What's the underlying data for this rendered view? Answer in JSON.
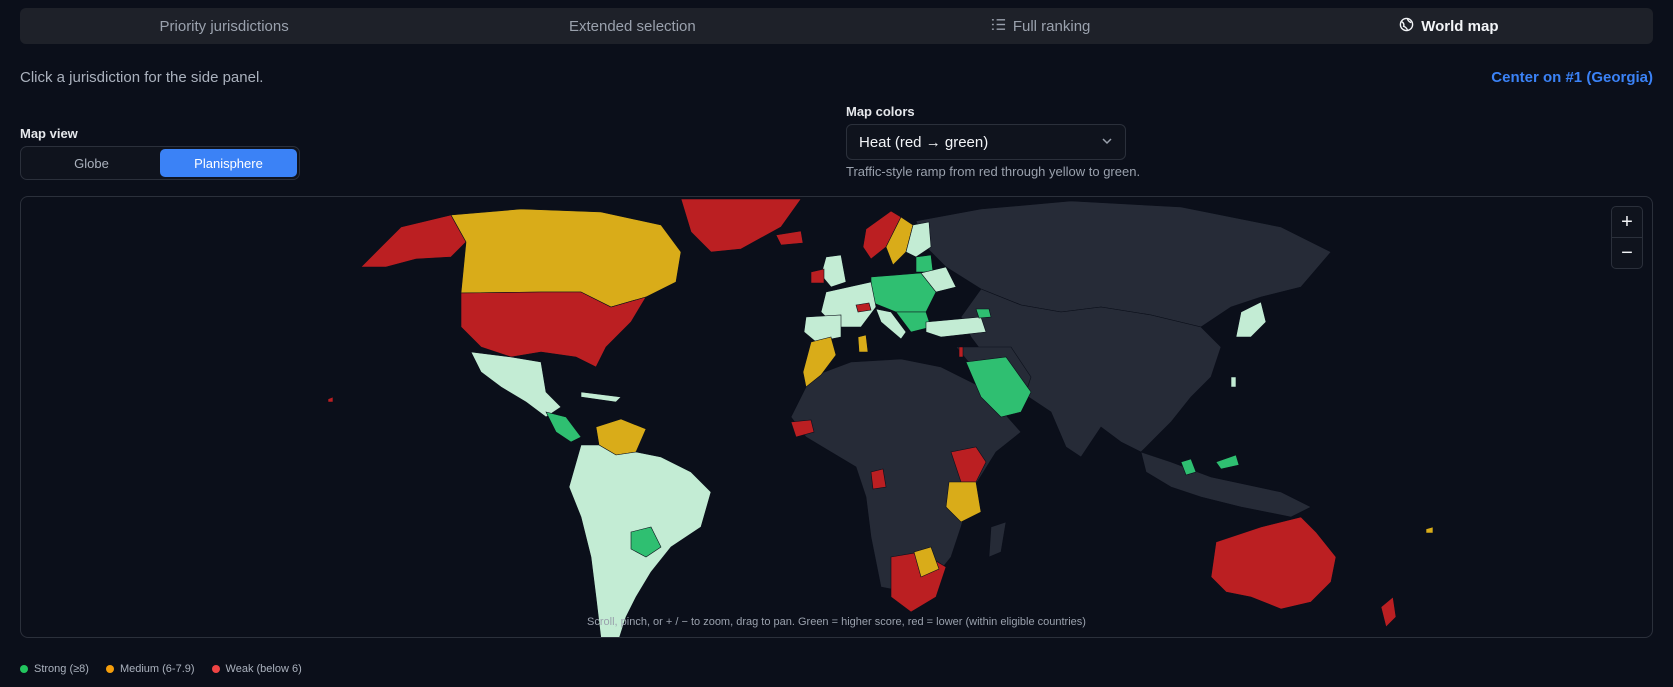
{
  "tabs": [
    {
      "label": "Priority jurisdictions",
      "active": false
    },
    {
      "label": "Extended selection",
      "active": false
    },
    {
      "label": "Full ranking",
      "icon": "list-icon",
      "active": false
    },
    {
      "label": "World map",
      "icon": "globe-icon",
      "active": true
    }
  ],
  "hint": "Click a jurisdiction for the side panel.",
  "center_link": "Center on #1 (Georgia)",
  "map_view": {
    "label": "Map view",
    "options": [
      "Globe",
      "Planisphere"
    ],
    "selected": "Planisphere"
  },
  "map_colors": {
    "label": "Map colors",
    "selected": "Heat (red → green)",
    "description": "Traffic-style ramp from red through yellow to green."
  },
  "map": {
    "zoom_in": "+",
    "zoom_out": "−",
    "note": "Scroll, pinch, or + / − to zoom, drag to pan. Green = higher score, red = lower (within eligible countries)",
    "colors": {
      "strong": "#2fbf71",
      "light": "#c3ecd4",
      "medium": "#d9ac19",
      "weak": "#bb1f22",
      "ineligible": "#262b37",
      "ocean": "#0b0f1a"
    }
  },
  "legend": [
    {
      "label": "Strong (≥8)",
      "color": "#22c55e"
    },
    {
      "label": "Medium (6-7.9)",
      "color": "#f59e0b"
    },
    {
      "label": "Weak (below 6)",
      "color": "#ef4444"
    }
  ]
}
